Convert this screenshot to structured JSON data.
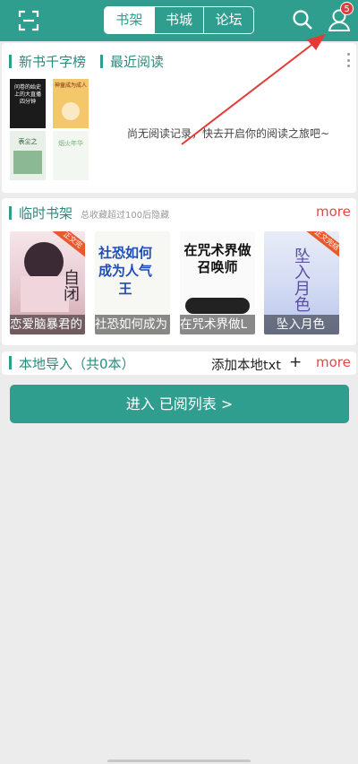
{
  "header": {
    "tabs": [
      {
        "label": "书架",
        "active": true
      },
      {
        "label": "书城",
        "active": false
      },
      {
        "label": "论坛",
        "active": false
      }
    ],
    "icons": {
      "scan": "scan-icon",
      "search": "search-icon",
      "user": "user-icon"
    },
    "notification_count": "5"
  },
  "colors": {
    "brand": "#2f9e8f",
    "accent_red": "#e24a4a",
    "badge": "#e23b3b"
  },
  "section_rank": {
    "title_left": "新书千字榜",
    "title_right": "最近阅读",
    "empty_message": "尚无阅读记录，快去开启你的阅读之旅吧~",
    "thumb_texts": [
      "问卷的始史上的大直播四分钟",
      "神童成为成人",
      "表尘之",
      "烟火年华"
    ]
  },
  "section_temp": {
    "title": "临时书架",
    "subtitle": "总收藏超过100后隐藏",
    "more": "more",
    "books": [
      {
        "title": "恋爱脑暴君的",
        "ribbon": "正文完",
        "cover_text": "自闭"
      },
      {
        "title": "社恐如何成为",
        "ribbon": "",
        "cover_text": "社恐如何成为人气王"
      },
      {
        "title": "在咒术界做L",
        "ribbon": "",
        "cover_text": "在咒术界做召唤师"
      },
      {
        "title": "坠入月色",
        "ribbon": "正文完结",
        "cover_text": "坠入月色"
      }
    ]
  },
  "section_local": {
    "title": "本地导入（共0本）",
    "add_label": "添加本地txt",
    "plus": "+",
    "more": "more"
  },
  "enter_button": "进入 已阅列表 >"
}
